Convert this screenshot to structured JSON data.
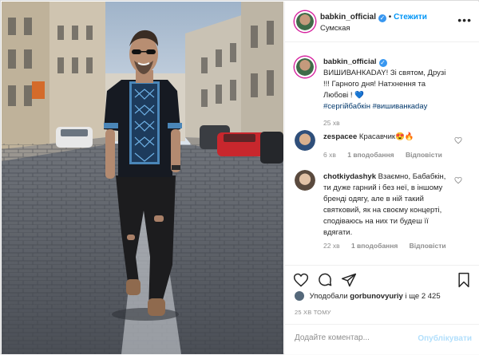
{
  "post": {
    "username": "babkin_official",
    "follow_label": "Стежити",
    "location": "Сумская"
  },
  "caption": {
    "username": "babkin_official",
    "text": "ВИШИВАНКАDAY! Зі святом, Друзі !!! Гарного дня! Натхнення та Любові ! 💙",
    "hashtags": "#сергійбабкін #вишиванкaday",
    "time": "25 хв"
  },
  "comments": [
    {
      "username": "zespacee",
      "text": "Красавчик😍🔥",
      "time": "6 хв",
      "likes": "1 вподобання",
      "reply": "Відповісти"
    },
    {
      "username": "chotkiydashyk",
      "text": "Взаємно, Бабабкін, ти дуже гарний і без неї, в іншому бренді одягу, але в ній такий святковий, як на своєму концерті, сподіваюсь на них ти будеш її вдягати.",
      "time": "22 хв",
      "likes": "1 вподобання",
      "reply": "Відповісти"
    }
  ],
  "likes": {
    "prefix": "Уподобали",
    "user": "gorbunovyuriy",
    "suffix": "і ще 2 425"
  },
  "timestamp": "25 ХВ ТОМУ",
  "add_comment": {
    "placeholder": "Додайте коментар...",
    "publish_label": "Опублікувати"
  },
  "colors": {
    "accent": "#0095f6",
    "publish_disabled": "#b2dffc",
    "meta_gray": "#8e8e8e"
  }
}
